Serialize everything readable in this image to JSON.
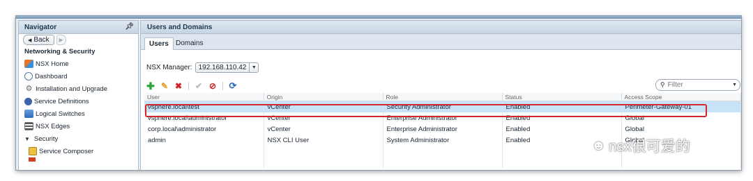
{
  "navigator": {
    "title": "Navigator",
    "back_label": "Back",
    "section": "Networking & Security",
    "items": [
      {
        "label": "NSX Home",
        "icon": "home-icon"
      },
      {
        "label": "Dashboard",
        "icon": "dashboard-icon"
      },
      {
        "label": "Installation and Upgrade",
        "icon": "gear-icon"
      },
      {
        "label": "Service Definitions",
        "icon": "service-icon"
      },
      {
        "label": "Logical Switches",
        "icon": "switch-icon"
      },
      {
        "label": "NSX Edges",
        "icon": "edge-icon"
      }
    ],
    "security_label": "Security",
    "sub_items": [
      {
        "label": "Service Composer",
        "icon": "composer-icon"
      }
    ]
  },
  "main": {
    "title": "Users and Domains",
    "tabs": [
      {
        "label": "Users"
      },
      {
        "label": "Domains"
      }
    ],
    "manager_label": "NSX Manager:",
    "manager_value": "192.168.110.42",
    "filter_placeholder": "Filter",
    "columns": [
      "User",
      "Origin",
      "Role",
      "Status",
      "Access Scope"
    ],
    "rows": [
      [
        "vsphere.local\\test",
        "vCenter",
        "Security Administrator",
        "Enabled",
        "Perimeter-Gateway-01"
      ],
      [
        "vsphere.local\\administrator",
        "vCenter",
        "Enterprise Administrator",
        "Enabled",
        "Global"
      ],
      [
        "corp.local\\administrator",
        "vCenter",
        "Enterprise Administrator",
        "Enabled",
        "Global"
      ],
      [
        "admin",
        "NSX CLI User",
        "System Administrator",
        "Enabled",
        "Global"
      ]
    ]
  },
  "watermark": {
    "text": "nsx很可爱的"
  },
  "colors": {
    "selected_row": "#c9e3f6",
    "highlight_box": "#d6262d",
    "add": "#2aa33a",
    "edit": "#e0a020",
    "delete": "#d22020"
  }
}
